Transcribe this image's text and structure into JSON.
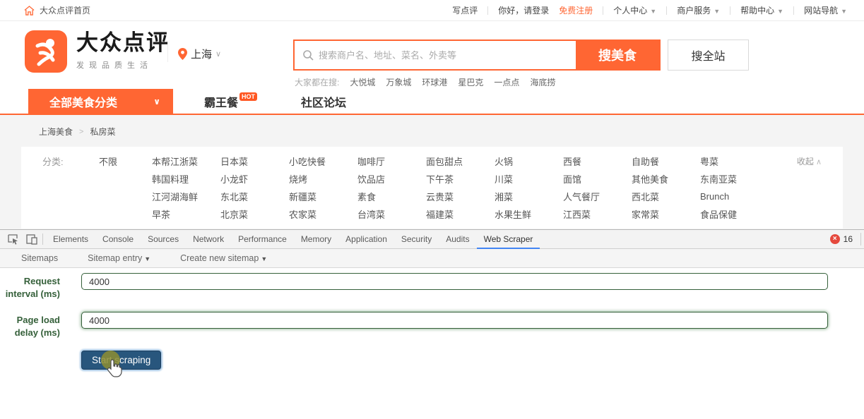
{
  "topbar": {
    "home": "大众点评首页",
    "write_review": "写点评",
    "greeting": "你好，请登录",
    "register": "免费注册",
    "menus": [
      "个人中心",
      "商户服务",
      "帮助中心",
      "网站导航"
    ]
  },
  "header": {
    "brand": "大众点评",
    "tagline": "发现品质生活",
    "city": "上海",
    "search": {
      "placeholder": "搜索商户名、地址、菜名、外卖等",
      "food_button": "搜美食",
      "all_button": "搜全站"
    },
    "hot_search": {
      "label": "大家都在搜:",
      "items": [
        "大悦城",
        "万象城",
        "环球港",
        "星巴克",
        "一点点",
        "海底捞"
      ]
    }
  },
  "nav": {
    "all_categories": "全部美食分类",
    "deal": "霸王餐",
    "hot_badge": "HOT",
    "forum": "社区论坛"
  },
  "breadcrumb": {
    "items": [
      "上海美食",
      "私房菜"
    ]
  },
  "filters": {
    "label": "分类:",
    "unlimited": "不限",
    "collapse": "收起",
    "rows": [
      [
        "本帮江浙菜",
        "日本菜",
        "小吃快餐",
        "咖啡厅",
        "面包甜点",
        "火锅",
        "西餐",
        "自助餐",
        "粤菜"
      ],
      [
        "韩国料理",
        "小龙虾",
        "烧烤",
        "饮品店",
        "下午茶",
        "川菜",
        "面馆",
        "其他美食",
        "东南亚菜"
      ],
      [
        "江河湖海鲜",
        "东北菜",
        "新疆菜",
        "素食",
        "云贵菜",
        "湘菜",
        "人气餐厅",
        "西北菜",
        "Brunch"
      ],
      [
        "早茶",
        "北京菜",
        "农家菜",
        "台湾菜",
        "福建菜",
        "水果生鲜",
        "江西菜",
        "家常菜",
        "食品保健"
      ]
    ]
  },
  "devtools": {
    "tabs": [
      "Elements",
      "Console",
      "Sources",
      "Network",
      "Performance",
      "Memory",
      "Application",
      "Security",
      "Audits",
      "Web Scraper"
    ],
    "active_tab": "Web Scraper",
    "error_count": "16"
  },
  "scraper": {
    "menus": [
      "Sitemaps",
      "Sitemap entry",
      "Create new sitemap"
    ],
    "request_interval_label_1": "Request",
    "request_interval_label_2": "interval (ms)",
    "request_interval_value": "4000",
    "page_load_label_1": "Page load",
    "page_load_label_2": "delay (ms)",
    "page_load_value": "4000",
    "start_button": "Start scraping"
  },
  "colors": {
    "brand_orange": "#ff6633",
    "devtools_active_blue": "#4285f4",
    "error_red": "#e5493d",
    "form_green": "#35603a",
    "button_navy": "#28567d"
  }
}
